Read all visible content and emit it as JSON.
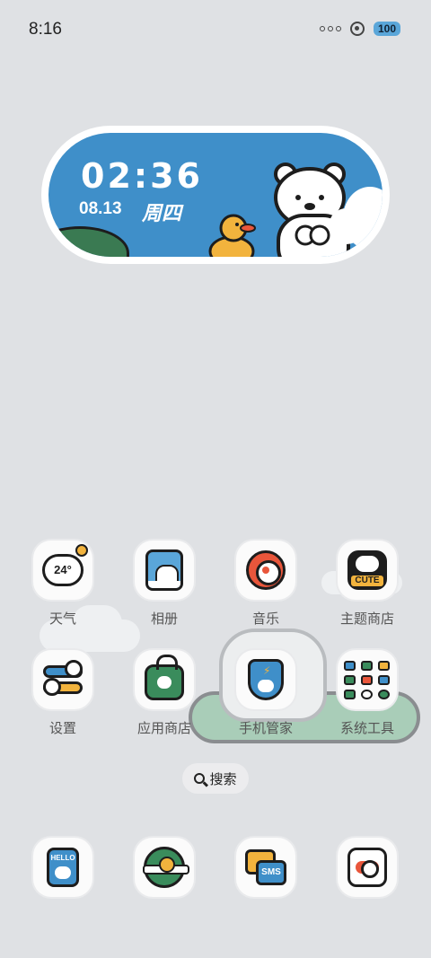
{
  "status_bar": {
    "time": "8:16",
    "battery": "100"
  },
  "widget": {
    "time": "02:36",
    "date": "08.13",
    "weekday": "周四"
  },
  "weather_icon": {
    "temp": "24°"
  },
  "theme_icon": {
    "badge": "CUTE"
  },
  "apps": [
    {
      "label": "天气",
      "icon": "weather-icon"
    },
    {
      "label": "相册",
      "icon": "gallery-icon"
    },
    {
      "label": "音乐",
      "icon": "music-icon"
    },
    {
      "label": "主题商店",
      "icon": "theme-store-icon"
    },
    {
      "label": "设置",
      "icon": "settings-icon"
    },
    {
      "label": "应用商店",
      "icon": "app-store-icon"
    },
    {
      "label": "手机管家",
      "icon": "phone-manager-icon"
    },
    {
      "label": "系统工具",
      "icon": "system-tools-folder-icon"
    }
  ],
  "search": {
    "label": "搜索"
  },
  "dock": [
    {
      "icon": "phone-icon",
      "text": "HELLO"
    },
    {
      "icon": "browser-icon"
    },
    {
      "icon": "sms-icon",
      "text": "SMS"
    },
    {
      "icon": "camera-icon"
    }
  ],
  "colors": {
    "background": "#dfe1e4",
    "sky_blue": "#3f8fc9",
    "yellow": "#f2b33d",
    "green": "#3a8c5c",
    "red": "#e9563b"
  }
}
